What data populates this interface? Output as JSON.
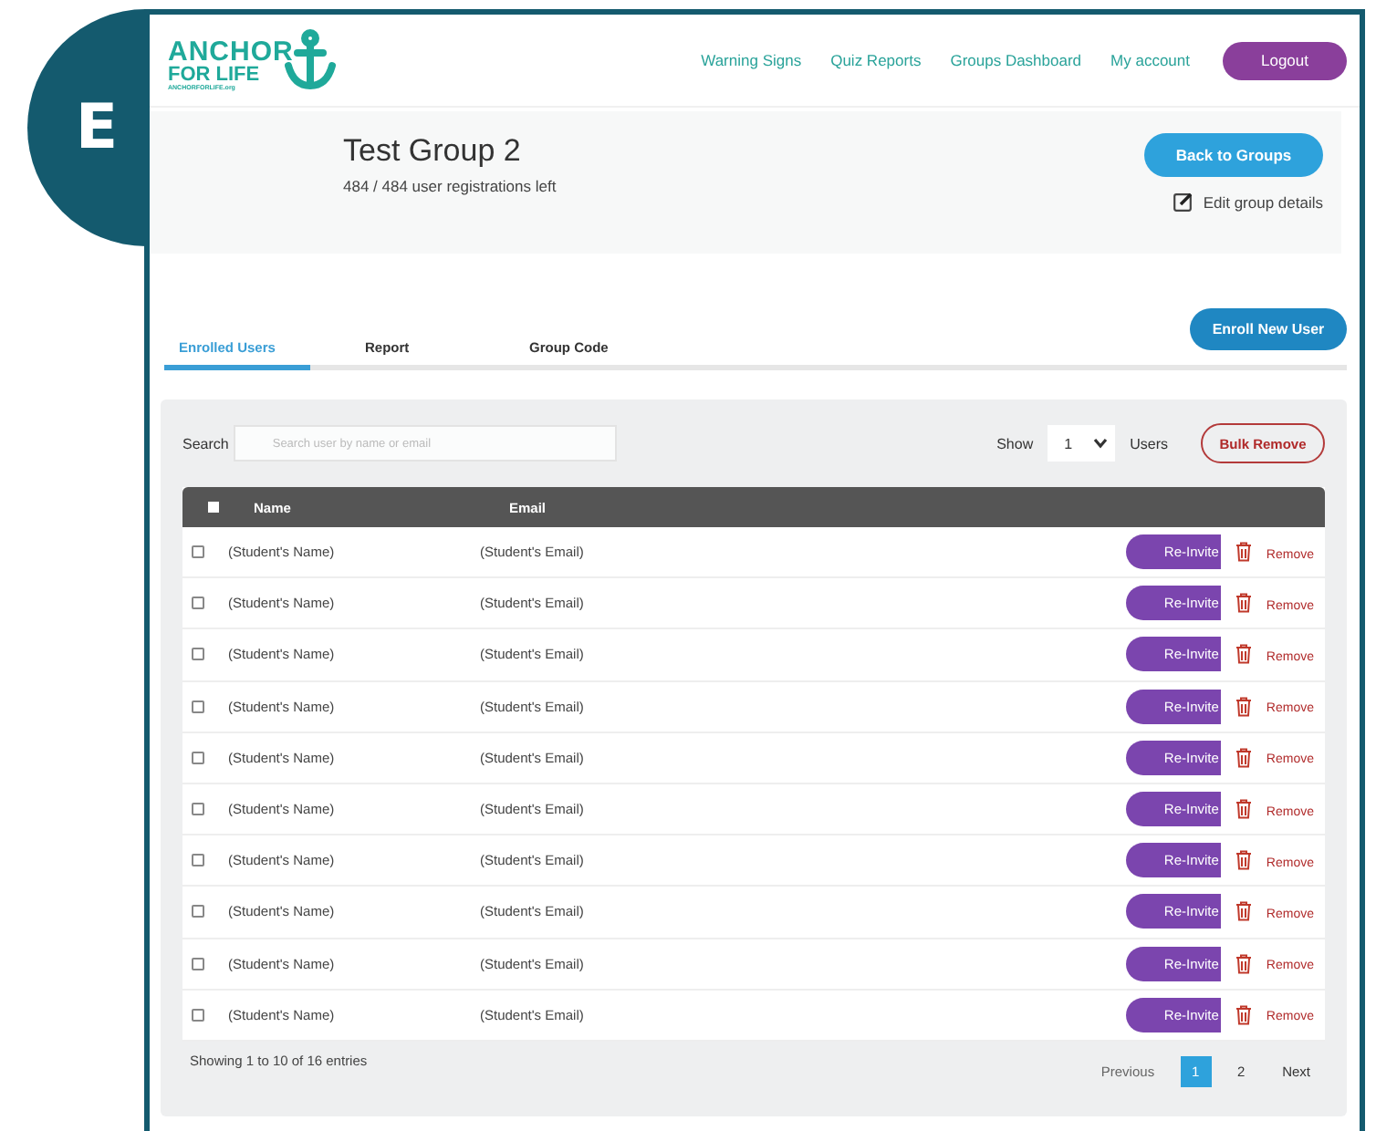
{
  "badge": {
    "letter": "E"
  },
  "logo": {
    "line_1": "ANCHOR",
    "line_2": "FOR LIFE",
    "tagline": "ANCHORFORLIFE.org"
  },
  "nav": {
    "links": [
      "Warning Signs",
      "Quiz Reports",
      "Groups Dashboard",
      "My account"
    ],
    "logout": "Logout"
  },
  "group": {
    "title": "Test Group 2",
    "registrations": "484 / 484 user registrations left",
    "back_button": "Back to Groups",
    "edit_link": "Edit group details"
  },
  "tabs": [
    {
      "label": "Enrolled Users",
      "selected": true
    },
    {
      "label": "Report",
      "selected": false
    },
    {
      "label": "Group Code",
      "selected": false
    }
  ],
  "enroll_button": "Enroll New User",
  "toolbar": {
    "search_label": "Search",
    "search_placeholder": "Search user by name or email",
    "show_label": "Show",
    "page_size": "1",
    "users_label": "Users",
    "bulk_remove": "Bulk Remove"
  },
  "table": {
    "select_all_checked": false,
    "columns": [
      "Name",
      "Email"
    ],
    "rows": [
      {
        "name": "(Student's Name)",
        "email": "(Student's Email)",
        "checked": false,
        "reinvite": "Re-Invite",
        "remove": "Remove"
      },
      {
        "name": "(Student's Name)",
        "email": "(Student's Email)",
        "checked": false,
        "reinvite": "Re-Invite",
        "remove": "Remove"
      },
      {
        "name": "(Student's Name)",
        "email": "(Student's Email)",
        "checked": false,
        "reinvite": "Re-Invite",
        "remove": "Remove"
      },
      {
        "name": "(Student's Name)",
        "email": "(Student's Email)",
        "checked": false,
        "reinvite": "Re-Invite",
        "remove": "Remove"
      },
      {
        "name": "(Student's Name)",
        "email": "(Student's Email)",
        "checked": false,
        "reinvite": "Re-Invite",
        "remove": "Remove"
      },
      {
        "name": "(Student's Name)",
        "email": "(Student's Email)",
        "checked": false,
        "reinvite": "Re-Invite",
        "remove": "Remove"
      },
      {
        "name": "(Student's Name)",
        "email": "(Student's Email)",
        "checked": false,
        "reinvite": "Re-Invite",
        "remove": "Remove"
      },
      {
        "name": "(Student's Name)",
        "email": "(Student's Email)",
        "checked": false,
        "reinvite": "Re-Invite",
        "remove": "Remove"
      },
      {
        "name": "(Student's Name)",
        "email": "(Student's Email)",
        "checked": false,
        "reinvite": "Re-Invite",
        "remove": "Remove"
      },
      {
        "name": "(Student's Name)",
        "email": "(Student's Email)",
        "checked": false,
        "reinvite": "Re-Invite",
        "remove": "Remove"
      }
    ]
  },
  "footer": {
    "summary": "Showing 1 to 10 of 16 entries",
    "previous": "Previous",
    "pages": [
      {
        "label": "1",
        "selected": true
      },
      {
        "label": "2",
        "selected": false
      }
    ],
    "next": "Next"
  }
}
